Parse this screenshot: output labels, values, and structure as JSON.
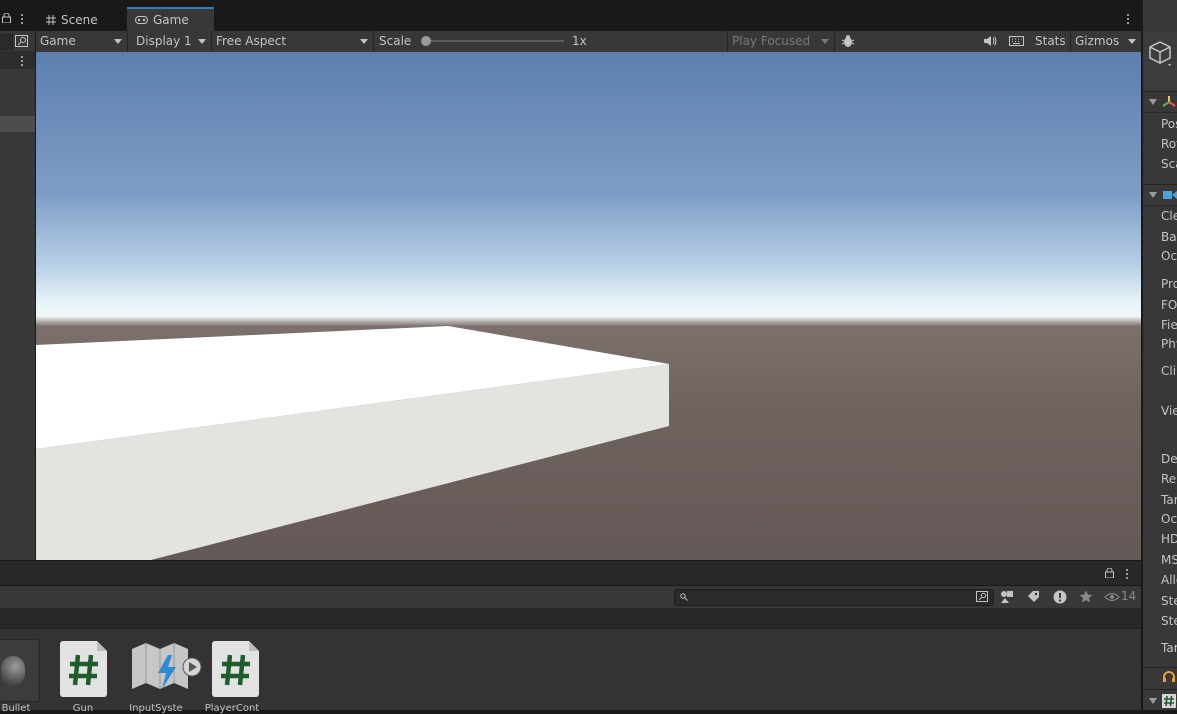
{
  "tabs": {
    "scene_label": "Scene",
    "game_label": "Game",
    "inspector_label": "In"
  },
  "toolbar": {
    "view_mode": "Game",
    "display": "Display 1",
    "aspect": "Free Aspect",
    "scale_label": "Scale",
    "scale_value": "1x",
    "scale_fraction": 0.0,
    "play_mode": "Play Focused",
    "stats_label": "Stats",
    "gizmos_label": "Gizmos"
  },
  "inspector": {
    "labels": [
      "Pos",
      "Rot",
      "Sca",
      "Cle",
      "Bac",
      "Oc",
      "Pro",
      "FO",
      "Fie",
      "Phy",
      "Clip",
      "Vie",
      "De",
      "Ren",
      "Tar",
      "Oc",
      "HD",
      "MS",
      "Allo",
      "Ste",
      "Ste",
      "Tar"
    ]
  },
  "project": {
    "search_placeholder": "",
    "hidden_count": "14",
    "assets": [
      {
        "name": "Bullet",
        "kind": "material"
      },
      {
        "name": "Gun",
        "kind": "script"
      },
      {
        "name": "InputSyste",
        "kind": "input-actions"
      },
      {
        "name": "PlayerCont",
        "kind": "script"
      }
    ]
  },
  "colors": {
    "accent": "#3a79bb",
    "panel": "#383838",
    "background": "#191919",
    "script_hash": "#1e5c2a"
  }
}
